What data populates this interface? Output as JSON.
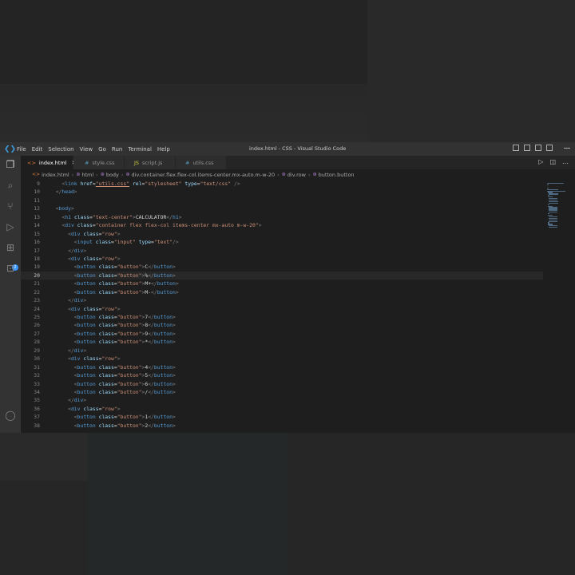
{
  "window": {
    "title": "index.html - CSS - Visual Studio Code",
    "menu": [
      "File",
      "Edit",
      "Selection",
      "View",
      "Go",
      "Run",
      "Terminal",
      "Help"
    ]
  },
  "tabs": [
    {
      "label": "index.html",
      "icon": "html-file-icon",
      "active": true
    },
    {
      "label": "style.css",
      "icon": "css-file-icon",
      "active": false
    },
    {
      "label": "script.js",
      "icon": "js-file-icon",
      "active": false
    },
    {
      "label": "utils.css",
      "icon": "css-file-icon",
      "active": false
    }
  ],
  "breadcrumb": [
    "index.html",
    "html",
    "body",
    "div.container.flex.flex-col.items-center.mx-auto.m-w-20",
    "div.row",
    "button.button"
  ],
  "editor": {
    "current_line": 20,
    "lines": [
      {
        "n": "9",
        "code": "    <link href=\"utils.css\" rel=\"stylesheet\" type=\"text/css\" />"
      },
      {
        "n": "10",
        "code": "  </head>"
      },
      {
        "n": "11",
        "code": ""
      },
      {
        "n": "12",
        "code": "  <body>"
      },
      {
        "n": "13",
        "code": "    <h1 class=\"text-center\">CALCULATOR</h1>"
      },
      {
        "n": "14",
        "code": "    <div class=\"container flex flex-col items-center mx-auto m-w-20\">"
      },
      {
        "n": "15",
        "code": "      <div class=\"row\">"
      },
      {
        "n": "16",
        "code": "        <input class=\"input\" type=\"text\"/>"
      },
      {
        "n": "17",
        "code": "      </div>"
      },
      {
        "n": "18",
        "code": "      <div class=\"row\">"
      },
      {
        "n": "19",
        "code": "        <button class=\"button\">C</button>"
      },
      {
        "n": "20",
        "code": "        <button class=\"button\">%</button>"
      },
      {
        "n": "21",
        "code": "        <button class=\"button\">M+</button>"
      },
      {
        "n": "22",
        "code": "        <button class=\"button\">M-</button>"
      },
      {
        "n": "23",
        "code": "      </div>"
      },
      {
        "n": "24",
        "code": "      <div class=\"row\">"
      },
      {
        "n": "25",
        "code": "        <button class=\"button\">7</button>"
      },
      {
        "n": "26",
        "code": "        <button class=\"button\">8</button>"
      },
      {
        "n": "27",
        "code": "        <button class=\"button\">9</button>"
      },
      {
        "n": "28",
        "code": "        <button class=\"button\">*</button>"
      },
      {
        "n": "29",
        "code": "      </div>"
      },
      {
        "n": "30",
        "code": "      <div class=\"row\">"
      },
      {
        "n": "31",
        "code": "        <button class=\"button\">4</button>"
      },
      {
        "n": "32",
        "code": "        <button class=\"button\">5</button>"
      },
      {
        "n": "33",
        "code": "        <button class=\"button\">6</button>"
      },
      {
        "n": "34",
        "code": "        <button class=\"button\">/</button>"
      },
      {
        "n": "35",
        "code": "      </div>"
      },
      {
        "n": "36",
        "code": "      <div class=\"row\">"
      },
      {
        "n": "37",
        "code": "        <button class=\"button\">1</button>"
      },
      {
        "n": "38",
        "code": "        <button class=\"button\">2</button>"
      }
    ]
  },
  "activity_bar": [
    "files-icon",
    "search-icon",
    "source-control-icon",
    "run-debug-icon",
    "extensions-icon",
    "remote-explorer-icon",
    "account-icon"
  ],
  "extensions_badge": "2",
  "colors": {
    "accent": "#3794ff",
    "tag": "#569cd6",
    "attr": "#9cdcfe",
    "string": "#ce9178"
  }
}
